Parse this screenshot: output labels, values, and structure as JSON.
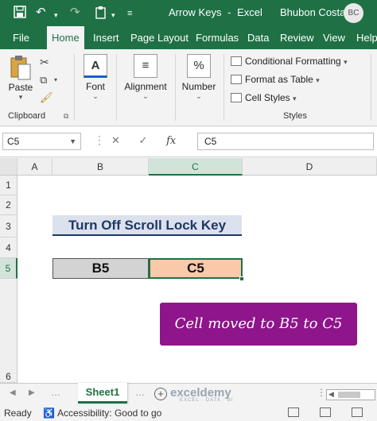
{
  "titlebar": {
    "doc_title": "Arrow Keys",
    "separator": "-",
    "app_name": "Excel",
    "user_name": "Bhubon Costa",
    "user_initials": "BC",
    "brand_color": "#1f7145"
  },
  "menu": {
    "tabs": [
      "File",
      "Home",
      "Insert",
      "Page Layout",
      "Formulas",
      "Data",
      "Review",
      "View",
      "Help"
    ],
    "active": "Home"
  },
  "ribbon": {
    "clipboard": {
      "paste_label": "Paste",
      "group_label": "Clipboard"
    },
    "font_label": "Font",
    "alignment_label": "Alignment",
    "number_label": "Number",
    "styles": {
      "conditional_formatting": "Conditional Formatting",
      "format_as_table": "Format as Table",
      "cell_styles": "Cell Styles",
      "group_label": "Styles"
    }
  },
  "formula_bar": {
    "name_box": "C5",
    "fx_label": "fx",
    "content": "C5"
  },
  "grid": {
    "columns": [
      "A",
      "B",
      "C",
      "D"
    ],
    "selected_column": "C",
    "rows": [
      "1",
      "2",
      "3",
      "4",
      "5",
      "6"
    ],
    "selected_row": "5",
    "heading": "Turn Off Scroll Lock Key",
    "cell_b5": "B5",
    "cell_c5": "C5",
    "note": "Cell moved to B5 to C5",
    "note_color": "#8e158b",
    "selected_fill": "#f9c9aa"
  },
  "sheets": {
    "active_sheet": "Sheet1",
    "watermark": "exceldemy",
    "watermark_sub": "EXCEL · DATA · BI"
  },
  "status": {
    "ready": "Ready",
    "accessibility": "Accessibility: Good to go"
  }
}
